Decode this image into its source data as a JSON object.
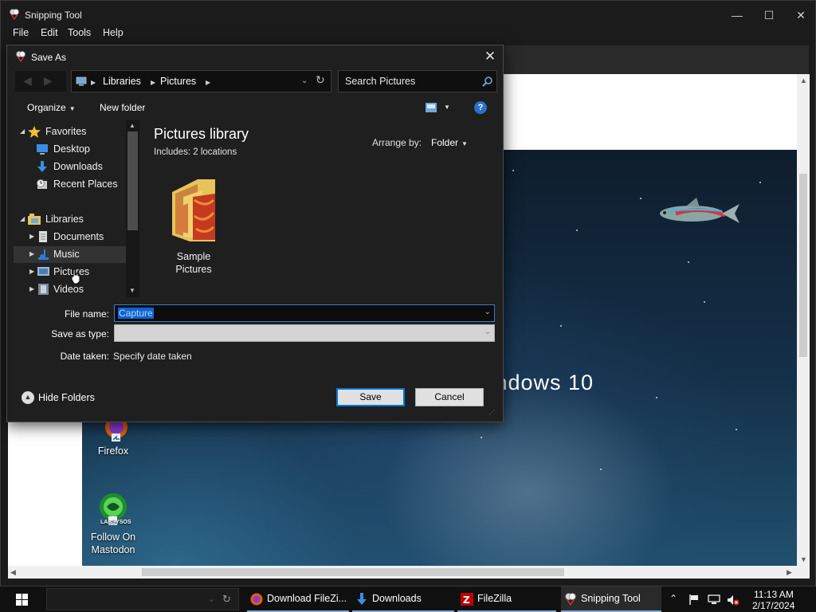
{
  "snipping_tool": {
    "title": "Snipping Tool",
    "menu": [
      "File",
      "Edit",
      "Tools",
      "Help"
    ],
    "window_controls": {
      "minimize": "—",
      "maximize": "☐",
      "close": "✕"
    }
  },
  "desktop": {
    "icons": [
      {
        "label": "Firefox"
      },
      {
        "label_line1": "Follow On",
        "label_line2": "Mastodon",
        "badge": "LABSYSOS"
      }
    ],
    "windows_text": "Windows 10"
  },
  "dialog": {
    "title": "Save As",
    "close": "✕",
    "breadcrumb": [
      "Libraries",
      "Pictures"
    ],
    "search_placeholder": "Search Pictures",
    "toolbar": {
      "organize": "Organize",
      "new_folder": "New folder",
      "help": "?"
    },
    "nav_tree": [
      {
        "label": "Favorites",
        "icon": "star-icon",
        "expand": "◢"
      },
      {
        "label": "Desktop",
        "icon": "desktop-icon"
      },
      {
        "label": "Downloads",
        "icon": "downloads-icon"
      },
      {
        "label": "Recent Places",
        "icon": "recent-places-icon"
      },
      {
        "label": "Libraries",
        "icon": "libraries-icon",
        "expand": "◢"
      },
      {
        "label": "Documents",
        "icon": "documents-icon",
        "expand": "▶"
      },
      {
        "label": "Music",
        "icon": "music-icon",
        "expand": "▶"
      },
      {
        "label": "Pictures",
        "icon": "pictures-icon",
        "expand": "▶"
      },
      {
        "label": "Videos",
        "icon": "videos-icon",
        "expand": "▶"
      }
    ],
    "content": {
      "library_title": "Pictures library",
      "includes": "Includes:  2 locations",
      "arrange_by_label": "Arrange by:",
      "arrange_by_value": "Folder",
      "items": [
        {
          "label_line1": "Sample",
          "label_line2": "Pictures"
        }
      ]
    },
    "form": {
      "file_name_label": "File name:",
      "file_name_value": "Capture",
      "save_as_type_label": "Save as type:",
      "date_taken_label": "Date taken:",
      "date_taken_value": "Specify date taken"
    },
    "hide_folders": "Hide Folders",
    "save": "Save",
    "cancel": "Cancel"
  },
  "taskbar": {
    "apps": [
      {
        "label": "Download FileZi...",
        "icon": "firefox-icon"
      },
      {
        "label": "Downloads",
        "icon": "downloads-icon"
      },
      {
        "label": "FileZilla",
        "icon": "filezilla-icon"
      },
      {
        "label": "Snipping Tool",
        "icon": "snipping-tool-icon",
        "active": true
      }
    ],
    "time": "11:13 AM",
    "date": "2/17/2024"
  },
  "colors": {
    "accent": "#0078d7",
    "selection": "#0a64d3",
    "dialog_bg": "#1f1f1f"
  }
}
